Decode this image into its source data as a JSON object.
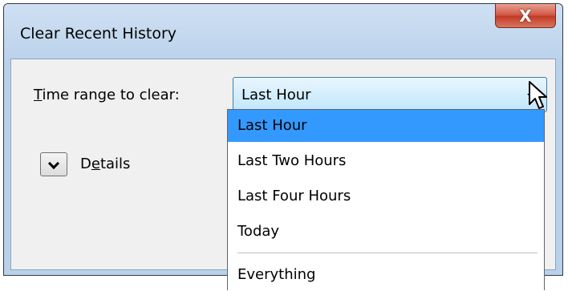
{
  "window": {
    "title": "Clear Recent History",
    "close_glyph": "X"
  },
  "time_range": {
    "label_mnemonic": "T",
    "label_rest": "ime range to clear:",
    "selected": "Last Hour",
    "options": [
      "Last Hour",
      "Last Two Hours",
      "Last Four Hours",
      "Today",
      "Everything"
    ]
  },
  "details": {
    "label_pre": "D",
    "label_mnemonic": "e",
    "label_rest": "tails"
  },
  "colors": {
    "selection": "#3399ff",
    "titlebar": "#bcd3ec",
    "close_button": "#c13a25"
  },
  "icons": [
    "close-icon",
    "dropdown-arrow-icon",
    "chevron-down-icon",
    "mouse-cursor-icon"
  ]
}
